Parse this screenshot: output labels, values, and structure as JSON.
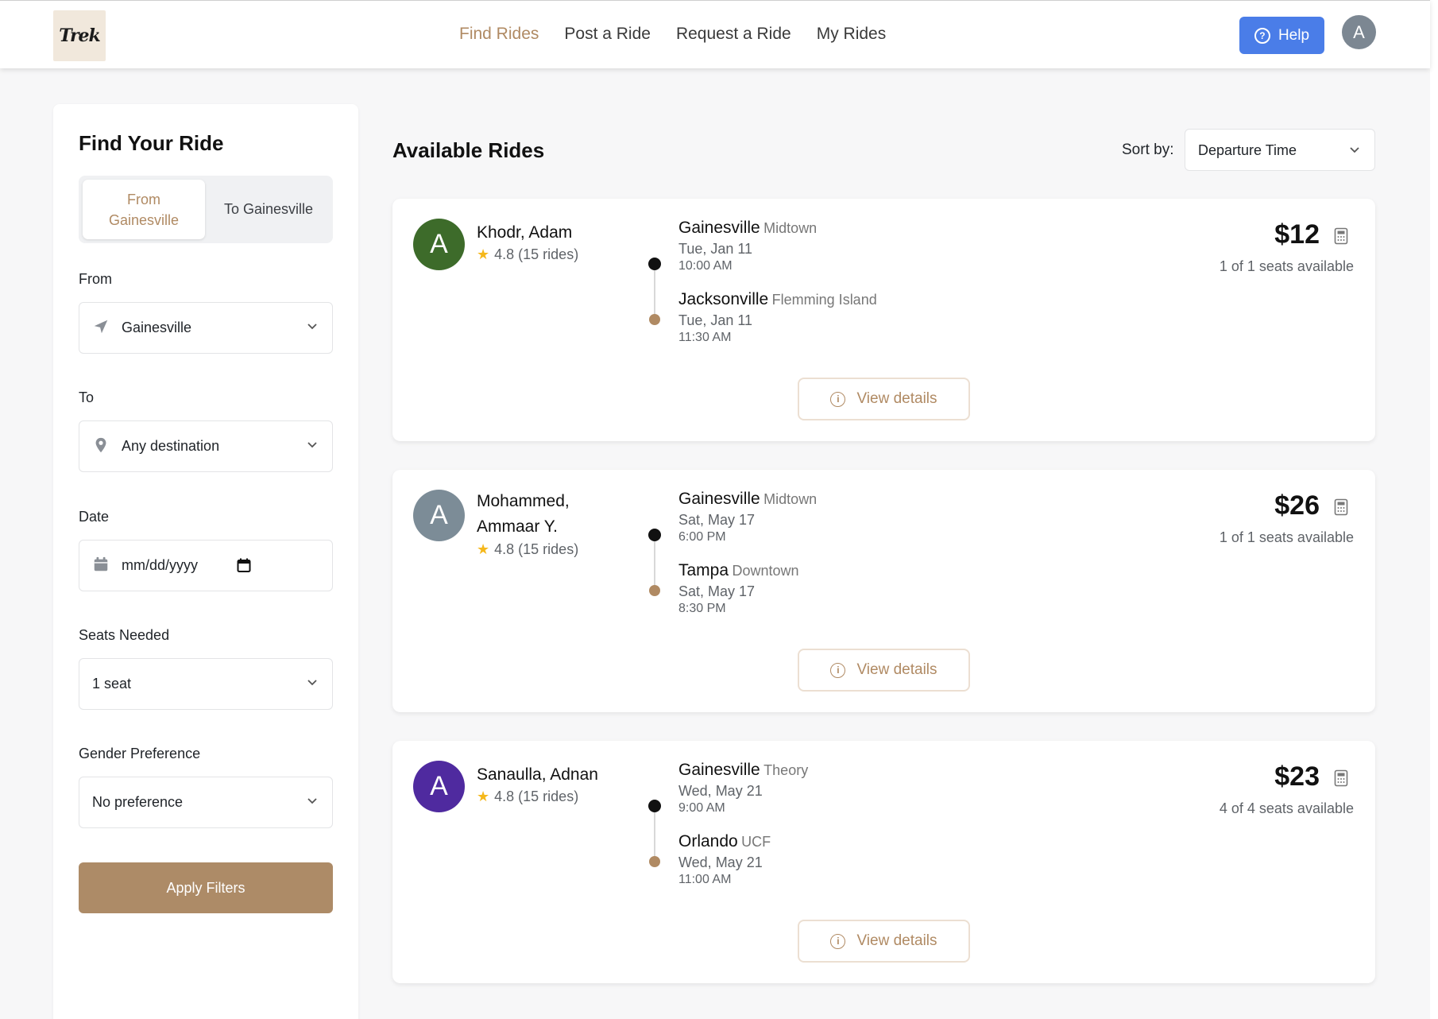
{
  "header": {
    "logo_text": "Trek",
    "nav": [
      "Find Rides",
      "Post a Ride",
      "Request a Ride",
      "My Rides"
    ],
    "help_label": "Help",
    "avatar_letter": "A"
  },
  "sidebar": {
    "title": "Find Your Ride",
    "toggle": {
      "option_a": "From Gainesville",
      "option_b": "To Gainesville"
    },
    "from": {
      "label": "From",
      "value": "Gainesville"
    },
    "to": {
      "label": "To",
      "value": "Any destination"
    },
    "date": {
      "label": "Date",
      "placeholder": "mm/dd/yyyy"
    },
    "seats": {
      "label": "Seats Needed",
      "value": "1 seat"
    },
    "gender": {
      "label": "Gender Preference",
      "value": "No preference"
    },
    "apply_label": "Apply Filters"
  },
  "main": {
    "title": "Available Rides",
    "sort_label": "Sort by:",
    "sort_value": "Departure Time",
    "details_label": "View details",
    "rides": [
      {
        "avatar_letter": "A",
        "avatar_color": "#3d6b2a",
        "driver": "Khodr, Adam",
        "rating": "4.8 (15 rides)",
        "from_city": "Gainesville",
        "from_area": "Midtown",
        "from_date": "Tue, Jan 11",
        "from_time": "10:00 AM",
        "to_city": "Jacksonville",
        "to_area": "Flemming Island",
        "to_date": "Tue, Jan 11",
        "to_time": "11:30 AM",
        "price": "$12",
        "seats": "1 of 1 seats available"
      },
      {
        "avatar_letter": "A",
        "avatar_color": "#7c8c97",
        "driver": "Mohammed, Ammaar Y.",
        "rating": "4.8 (15 rides)",
        "from_city": "Gainesville",
        "from_area": "Midtown",
        "from_date": "Sat, May 17",
        "from_time": "6:00 PM",
        "to_city": "Tampa",
        "to_area": "Downtown",
        "to_date": "Sat, May 17",
        "to_time": "8:30 PM",
        "price": "$26",
        "seats": "1 of 1 seats available"
      },
      {
        "avatar_letter": "A",
        "avatar_color": "#4f2a9f",
        "driver": "Sanaulla, Adnan",
        "rating": "4.8 (15 rides)",
        "from_city": "Gainesville",
        "from_area": "Theory",
        "from_date": "Wed, May 21",
        "from_time": "9:00 AM",
        "to_city": "Orlando",
        "to_area": "UCF",
        "to_date": "Wed, May 21",
        "to_time": "11:00 AM",
        "price": "$23",
        "seats": "4 of 4 seats available"
      }
    ]
  },
  "colors": {
    "accent": "#b08a63",
    "help_blue": "#4a7de8",
    "apply_brown": "#ad8b67"
  }
}
